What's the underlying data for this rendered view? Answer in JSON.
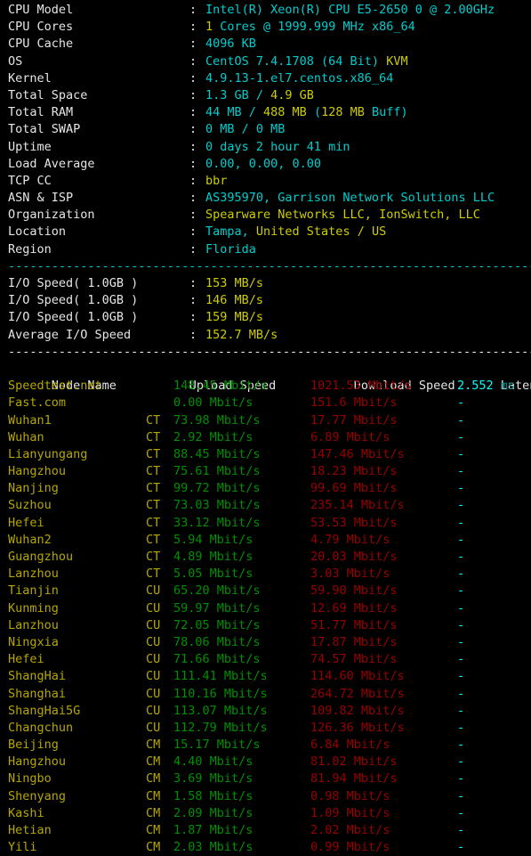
{
  "sysinfo": {
    "rows": [
      {
        "label": "CPU Model",
        "segments": [
          {
            "text": "Intel(R) Xeon(R) CPU E5-2650 0 @ 2.00GHz",
            "color": "cyan"
          }
        ]
      },
      {
        "label": "CPU Cores",
        "segments": [
          {
            "text": "1",
            "color": "yellow"
          },
          {
            "text": " Cores @ ",
            "color": "cyan"
          },
          {
            "text": "1999.999",
            "color": "cyan"
          },
          {
            "text": " MHz ",
            "color": "cyan"
          },
          {
            "text": "x86_64",
            "color": "cyan"
          }
        ]
      },
      {
        "label": "CPU Cache",
        "segments": [
          {
            "text": "4096 KB",
            "color": "cyan"
          }
        ]
      },
      {
        "label": "OS",
        "segments": [
          {
            "text": "CentOS 7.4.1708 (64 Bit) ",
            "color": "cyan"
          },
          {
            "text": "KVM",
            "color": "yellow"
          }
        ]
      },
      {
        "label": "Kernel",
        "segments": [
          {
            "text": "4.9.13-1.el7.centos.x86_64",
            "color": "cyan"
          }
        ]
      },
      {
        "label": "Total Space",
        "segments": [
          {
            "text": "1.3 GB",
            "color": "cyan"
          },
          {
            "text": " / ",
            "color": "cyan"
          },
          {
            "text": "4.9 GB",
            "color": "yellow"
          }
        ]
      },
      {
        "label": "Total RAM",
        "segments": [
          {
            "text": "44 MB",
            "color": "cyan"
          },
          {
            "text": " / ",
            "color": "cyan"
          },
          {
            "text": "488 MB",
            "color": "yellow"
          },
          {
            "text": " (",
            "color": "cyan"
          },
          {
            "text": "128 MB",
            "color": "yellow"
          },
          {
            "text": " Buff)",
            "color": "cyan"
          }
        ]
      },
      {
        "label": "Total SWAP",
        "segments": [
          {
            "text": "0 MB",
            "color": "cyan"
          },
          {
            "text": " / ",
            "color": "cyan"
          },
          {
            "text": "0 MB",
            "color": "cyan"
          }
        ]
      },
      {
        "label": "Uptime",
        "segments": [
          {
            "text": "0 days 2 hour 41 min",
            "color": "cyan"
          }
        ]
      },
      {
        "label": "Load Average",
        "segments": [
          {
            "text": "0.00, 0.00, 0.00",
            "color": "cyan"
          }
        ]
      },
      {
        "label": "TCP CC",
        "segments": [
          {
            "text": "bbr",
            "color": "yellow"
          }
        ]
      },
      {
        "label": "ASN & ISP",
        "segments": [
          {
            "text": "AS395970, Garrison Network Solutions LLC",
            "color": "cyan"
          }
        ]
      },
      {
        "label": "Organization",
        "segments": [
          {
            "text": "Spearware Networks LLC, IonSwitch, LLC",
            "color": "yellow"
          }
        ]
      },
      {
        "label": "Location",
        "segments": [
          {
            "text": "Tampa, ",
            "color": "cyan"
          },
          {
            "text": "United States / US",
            "color": "yellow"
          }
        ]
      },
      {
        "label": "Region",
        "segments": [
          {
            "text": "Florida",
            "color": "cyan"
          }
        ]
      }
    ],
    "colon": ":"
  },
  "io": {
    "rows": [
      {
        "label": "I/O Speed( 1.0GB )",
        "value": "153 MB/s"
      },
      {
        "label": "I/O Speed( 1.0GB )",
        "value": "146 MB/s"
      },
      {
        "label": "I/O Speed( 1.0GB )",
        "value": "159 MB/s"
      },
      {
        "label": "Average I/O Speed",
        "value": "152.7 MB/s"
      }
    ],
    "colon": ":"
  },
  "separators": {
    "dash_cyan": "----------------------------------------------------------------------",
    "dash_white": "----------------------------------------------------------------------"
  },
  "speedtest": {
    "header": {
      "node": "Node Name",
      "upload": "Upload Speed",
      "download": "Download Speed",
      "latency": "Latency"
    },
    "rows": [
      {
        "node": "Speedtest.net",
        "isp": "",
        "upload": "148.45 Mbit/s",
        "download": "1021.53 Mbit/s",
        "latency": "2.552",
        "latency_unit": "ms"
      },
      {
        "node": "Fast.com",
        "isp": "",
        "upload": "0.00 Mbit/s",
        "download": "151.6 Mbit/s",
        "latency": "-",
        "latency_unit": ""
      },
      {
        "node": "Wuhan1",
        "isp": "CT",
        "upload": "73.98 Mbit/s",
        "download": "17.77 Mbit/s",
        "latency": "-",
        "latency_unit": ""
      },
      {
        "node": "Wuhan",
        "isp": "CT",
        "upload": "2.92 Mbit/s",
        "download": "6.89 Mbit/s",
        "latency": "-",
        "latency_unit": ""
      },
      {
        "node": "Lianyungang",
        "isp": "CT",
        "upload": "88.45 Mbit/s",
        "download": "147.46 Mbit/s",
        "latency": "-",
        "latency_unit": ""
      },
      {
        "node": "Hangzhou",
        "isp": "CT",
        "upload": "75.61 Mbit/s",
        "download": "18.23 Mbit/s",
        "latency": "-",
        "latency_unit": ""
      },
      {
        "node": "Nanjing",
        "isp": "CT",
        "upload": "99.72 Mbit/s",
        "download": "99.69 Mbit/s",
        "latency": "-",
        "latency_unit": ""
      },
      {
        "node": "Suzhou",
        "isp": "CT",
        "upload": "73.03 Mbit/s",
        "download": "235.14 Mbit/s",
        "latency": "-",
        "latency_unit": ""
      },
      {
        "node": "Hefei",
        "isp": "CT",
        "upload": "33.12 Mbit/s",
        "download": "53.53 Mbit/s",
        "latency": "-",
        "latency_unit": ""
      },
      {
        "node": "Wuhan2",
        "isp": "CT",
        "upload": "5.94 Mbit/s",
        "download": "4.79 Mbit/s",
        "latency": "-",
        "latency_unit": ""
      },
      {
        "node": "Guangzhou",
        "isp": "CT",
        "upload": "4.89 Mbit/s",
        "download": "20.03 Mbit/s",
        "latency": "-",
        "latency_unit": ""
      },
      {
        "node": "Lanzhou",
        "isp": "CT",
        "upload": "5.05 Mbit/s",
        "download": "3.03 Mbit/s",
        "latency": "-",
        "latency_unit": ""
      },
      {
        "node": "Tianjin",
        "isp": "CU",
        "upload": "65.20 Mbit/s",
        "download": "59.90 Mbit/s",
        "latency": "-",
        "latency_unit": ""
      },
      {
        "node": "Kunming",
        "isp": "CU",
        "upload": "59.97 Mbit/s",
        "download": "12.69 Mbit/s",
        "latency": "-",
        "latency_unit": ""
      },
      {
        "node": "Lanzhou",
        "isp": "CU",
        "upload": "72.05 Mbit/s",
        "download": "51.77 Mbit/s",
        "latency": "-",
        "latency_unit": ""
      },
      {
        "node": "Ningxia",
        "isp": "CU",
        "upload": "78.06 Mbit/s",
        "download": "17.87 Mbit/s",
        "latency": "-",
        "latency_unit": ""
      },
      {
        "node": "Hefei",
        "isp": "CU",
        "upload": "71.66 Mbit/s",
        "download": "74.57 Mbit/s",
        "latency": "-",
        "latency_unit": ""
      },
      {
        "node": "ShangHai",
        "isp": "CU",
        "upload": "111.41 Mbit/s",
        "download": "114.60 Mbit/s",
        "latency": "-",
        "latency_unit": ""
      },
      {
        "node": "Shanghai",
        "isp": "CU",
        "upload": "110.16 Mbit/s",
        "download": "264.72 Mbit/s",
        "latency": "-",
        "latency_unit": ""
      },
      {
        "node": "ShangHai5G",
        "isp": "CU",
        "upload": "113.07 Mbit/s",
        "download": "109.82 Mbit/s",
        "latency": "-",
        "latency_unit": ""
      },
      {
        "node": "Changchun",
        "isp": "CU",
        "upload": "112.79 Mbit/s",
        "download": "126.36 Mbit/s",
        "latency": "-",
        "latency_unit": ""
      },
      {
        "node": "Beijing",
        "isp": "CM",
        "upload": "15.17 Mbit/s",
        "download": "6.84 Mbit/s",
        "latency": "-",
        "latency_unit": ""
      },
      {
        "node": "Hangzhou",
        "isp": "CM",
        "upload": "4.40 Mbit/s",
        "download": "81.02 Mbit/s",
        "latency": "-",
        "latency_unit": ""
      },
      {
        "node": "Ningbo",
        "isp": "CM",
        "upload": "3.69 Mbit/s",
        "download": "81.94 Mbit/s",
        "latency": "-",
        "latency_unit": ""
      },
      {
        "node": "Shenyang",
        "isp": "CM",
        "upload": "1.58 Mbit/s",
        "download": "0.98 Mbit/s",
        "latency": "-",
        "latency_unit": ""
      },
      {
        "node": "Kashi",
        "isp": "CM",
        "upload": "2.09 Mbit/s",
        "download": "1.09 Mbit/s",
        "latency": "-",
        "latency_unit": ""
      },
      {
        "node": "Hetian",
        "isp": "CM",
        "upload": "1.87 Mbit/s",
        "download": "2.02 Mbit/s",
        "latency": "-",
        "latency_unit": ""
      },
      {
        "node": "Yili",
        "isp": "CM",
        "upload": "2.03 Mbit/s",
        "download": "0.99 Mbit/s",
        "latency": "-",
        "latency_unit": ""
      }
    ]
  },
  "palette": {
    "background": "#000000",
    "label": "#e6e6e6",
    "cyan": "#00cdcd",
    "yellow": "#cdcd00",
    "olive": "#b5a600",
    "upload_green": "#008f00",
    "download_red": "#980000",
    "latency_cyan": "#00cdcd"
  }
}
